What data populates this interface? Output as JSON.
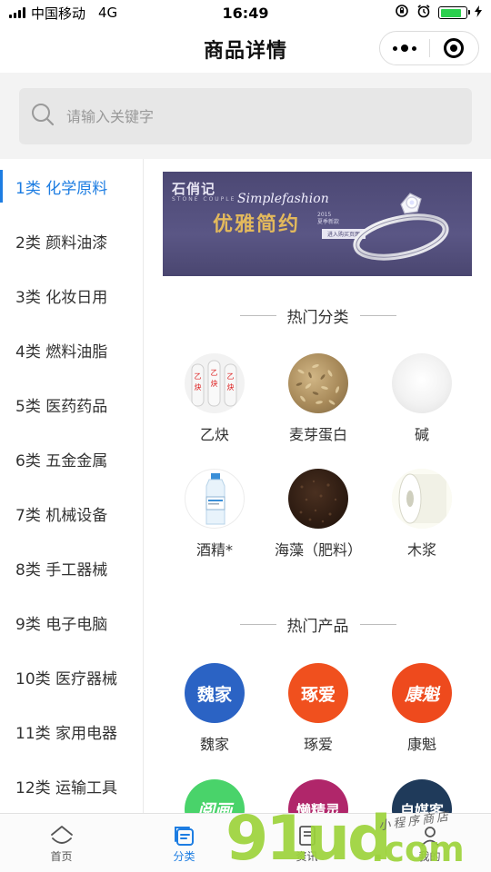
{
  "status_bar": {
    "carrier": "中国移动",
    "network": "4G",
    "time": "16:49",
    "battery_level": 0.85
  },
  "nav": {
    "title": "商品详情",
    "more_icon": "more-dots-icon",
    "close_icon": "target-circle-icon"
  },
  "search": {
    "placeholder": "请输入关键字",
    "value": ""
  },
  "sidebar": {
    "items": [
      {
        "label": "1类 化学原料",
        "active": true
      },
      {
        "label": "2类 颜料油漆",
        "active": false
      },
      {
        "label": "3类 化妆日用",
        "active": false
      },
      {
        "label": "4类 燃料油脂",
        "active": false
      },
      {
        "label": "5类 医药药品",
        "active": false
      },
      {
        "label": "6类 五金金属",
        "active": false
      },
      {
        "label": "7类 机械设备",
        "active": false
      },
      {
        "label": "8类 手工器械",
        "active": false
      },
      {
        "label": "9类 电子电脑",
        "active": false
      },
      {
        "label": "10类 医疗器械",
        "active": false
      },
      {
        "label": "11类 家用电器",
        "active": false
      },
      {
        "label": "12类 运输工具",
        "active": false
      }
    ]
  },
  "banner": {
    "brand": "石俏记",
    "brand_sub": "STONE COUPLE",
    "script": "Simplefashion",
    "headline": "优雅简约",
    "note_1": "2015",
    "note_2": "夏季新款",
    "tag": "进入购买页面"
  },
  "hot_categories": {
    "title": "热门分类",
    "items": [
      {
        "label": "乙炔",
        "icon": "gas-cylinders-image"
      },
      {
        "label": "麦芽蛋白",
        "icon": "malt-grains-image"
      },
      {
        "label": "碱",
        "icon": "white-powder-image"
      },
      {
        "label": "酒精*",
        "icon": "alcohol-bottle-image"
      },
      {
        "label": "海藻（肥料）",
        "icon": "seaweed-fertilizer-image"
      },
      {
        "label": "木浆",
        "icon": "wood-pulp-roll-image"
      }
    ]
  },
  "hot_products": {
    "title": "热门产品",
    "items": [
      {
        "label": "魏家",
        "logo_text": "魏家",
        "color": "#2b63c4"
      },
      {
        "label": "琢爱",
        "logo_text": "琢爱",
        "color": "#f0501e"
      },
      {
        "label": "康魁",
        "logo_text": "康魁",
        "color": "#ee4a1d"
      }
    ],
    "partial_items": [
      {
        "logo_text": "阅画",
        "color": "#49d36a"
      },
      {
        "logo_text": "懒精灵",
        "color": "#b0266a"
      },
      {
        "logo_text": "自媒客",
        "color": "#1f3a5a"
      }
    ]
  },
  "tab_bar": {
    "tabs": [
      {
        "label": "首页",
        "icon": "home-icon",
        "active": false
      },
      {
        "label": "分类",
        "icon": "category-icon",
        "active": true
      },
      {
        "label": "资讯",
        "icon": "news-icon",
        "active": false
      },
      {
        "label": "我的",
        "icon": "profile-icon",
        "active": false
      }
    ]
  },
  "watermark": {
    "digits": "91ud",
    "suffix": ".com",
    "script": "小程序商店"
  },
  "colors": {
    "accent": "#1d7de2",
    "battery": "#2bd04e",
    "watermark": "#9dd33c"
  }
}
